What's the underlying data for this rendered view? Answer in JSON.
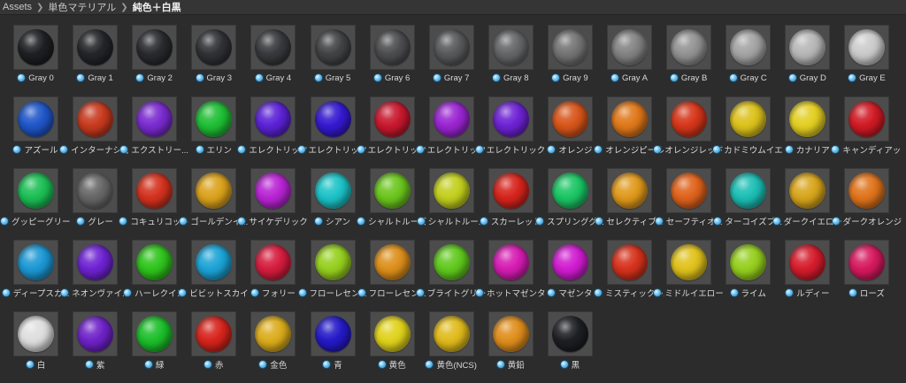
{
  "breadcrumb": [
    "Assets",
    "単色マテリアル",
    "純色＋白黒"
  ],
  "materials": [
    {
      "label": "Gray 0",
      "color": "#1e1f22"
    },
    {
      "label": "Gray 1",
      "color": "#232528"
    },
    {
      "label": "Gray 2",
      "color": "#282a2d"
    },
    {
      "label": "Gray 3",
      "color": "#2f3134"
    },
    {
      "label": "Gray 4",
      "color": "#37393c"
    },
    {
      "label": "Gray 5",
      "color": "#414345"
    },
    {
      "label": "Gray 6",
      "color": "#4c4d4f"
    },
    {
      "label": "Gray 7",
      "color": "#58595b"
    },
    {
      "label": "Gray 8",
      "color": "#656667"
    },
    {
      "label": "Gray 9",
      "color": "#747475"
    },
    {
      "label": "Gray A",
      "color": "#838384"
    },
    {
      "label": "Gray B",
      "color": "#939394"
    },
    {
      "label": "Gray C",
      "color": "#a4a4a5"
    },
    {
      "label": "Gray D",
      "color": "#b7b7b8"
    },
    {
      "label": "Gray E",
      "color": "#cbcbcc"
    },
    {
      "label": "アズール",
      "color": "#1f56c8"
    },
    {
      "label": "インターナショ...",
      "color": "#c83a1e"
    },
    {
      "label": "エクストリー...",
      "color": "#7a2bd0"
    },
    {
      "label": "エリン",
      "color": "#1fbf35"
    },
    {
      "label": "エレクトリック...",
      "color": "#5b22d6"
    },
    {
      "label": "エレクトリック...",
      "color": "#3419d0"
    },
    {
      "label": "エレクトリック...",
      "color": "#c8182e"
    },
    {
      "label": "エレクトリック...",
      "color": "#9a25d2"
    },
    {
      "label": "エレクトリック...",
      "color": "#6d22d4"
    },
    {
      "label": "オレンジ",
      "color": "#d8561a"
    },
    {
      "label": "オレンジピール",
      "color": "#e0781a"
    },
    {
      "label": "オレンジレッド",
      "color": "#d6361a"
    },
    {
      "label": "カドミウムイエ...",
      "color": "#dcc21c"
    },
    {
      "label": "カナリア",
      "color": "#e3cf22"
    },
    {
      "label": "キャンディアッ...",
      "color": "#d11a24"
    },
    {
      "label": "グッピーグリーン",
      "color": "#1cbf55"
    },
    {
      "label": "グレー",
      "color": "#676767"
    },
    {
      "label": "コキュリコット",
      "color": "#d4321e"
    },
    {
      "label": "ゴールデンイ...",
      "color": "#dba21c"
    },
    {
      "label": "サイケデリック...",
      "color": "#b824d4"
    },
    {
      "label": "シアン",
      "color": "#1cc3c8"
    },
    {
      "label": "シャルトルーズ",
      "color": "#6cc61e"
    },
    {
      "label": "シャルトルー...",
      "color": "#c2cf1e"
    },
    {
      "label": "スカーレット",
      "color": "#d6241c"
    },
    {
      "label": "スプリンググ...",
      "color": "#1cc665"
    },
    {
      "label": "セレクティブ...",
      "color": "#e09a1c"
    },
    {
      "label": "セーフティオ...",
      "color": "#e0631c"
    },
    {
      "label": "ターコイズブ...",
      "color": "#1cbfb5"
    },
    {
      "label": "ダークイエロー",
      "color": "#d8a61c"
    },
    {
      "label": "ダークオレンジ",
      "color": "#e0741c"
    },
    {
      "label": "ディープスカ...",
      "color": "#1c98d4"
    },
    {
      "label": "ネオンヴァイ...",
      "color": "#6e22d2"
    },
    {
      "label": "ハーレクイン",
      "color": "#2fc41c"
    },
    {
      "label": "ビビットスカイ...",
      "color": "#1ca3d6"
    },
    {
      "label": "フォリー",
      "color": "#d61c3e"
    },
    {
      "label": "フローレセン...",
      "color": "#96cf1e"
    },
    {
      "label": "フローレセン...",
      "color": "#dd8f1c"
    },
    {
      "label": "ブライトグリーン",
      "color": "#60c91e"
    },
    {
      "label": "ホットマゼンタ",
      "color": "#d61cb3"
    },
    {
      "label": "マゼンタ",
      "color": "#d01cd0"
    },
    {
      "label": "ミスティックレ...",
      "color": "#d6321c"
    },
    {
      "label": "ミドルイエロー",
      "color": "#e0c21c"
    },
    {
      "label": "ライム",
      "color": "#96cf1e"
    },
    {
      "label": "ルディー",
      "color": "#d61c2c"
    },
    {
      "label": "ローズ",
      "color": "#d6195e"
    },
    {
      "label": "白",
      "color": "#dedede"
    },
    {
      "label": "紫",
      "color": "#6e22c8"
    },
    {
      "label": "緑",
      "color": "#1cbf2a"
    },
    {
      "label": "赤",
      "color": "#d6241c"
    },
    {
      "label": "金色",
      "color": "#dbac1c"
    },
    {
      "label": "青",
      "color": "#2419c8"
    },
    {
      "label": "黄色",
      "color": "#e0d21c"
    },
    {
      "label": "黄色(NCS)",
      "color": "#e0bb1c"
    },
    {
      "label": "黄鉛",
      "color": "#df8e1c"
    },
    {
      "label": "黒",
      "color": "#1d1f23"
    }
  ]
}
